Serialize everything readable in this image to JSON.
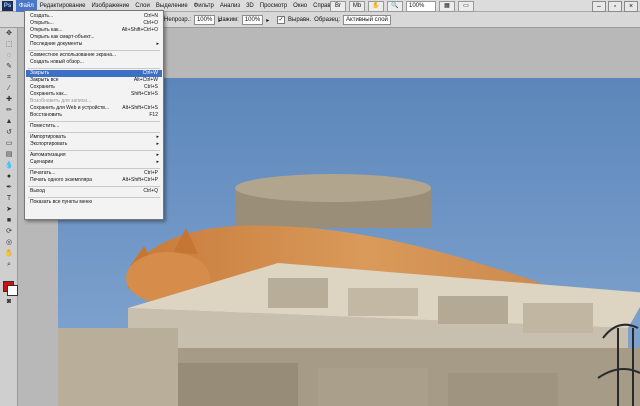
{
  "app": {
    "logo": "Ps"
  },
  "menubar": {
    "items": [
      "Файл",
      "Редактирование",
      "Изображение",
      "Слои",
      "Выделение",
      "Фильтр",
      "Анализ",
      "3D",
      "Просмотр",
      "Окно",
      "Справка"
    ],
    "active_index": 0,
    "zoom": "100%"
  },
  "options": {
    "opacity_label": "Непрозр.:",
    "opacity_value": "100%",
    "pressure_label": "Нажим:",
    "pressure_value": "100%",
    "align_label": "Выравн.",
    "sample_label": "Образец:",
    "sample_value": "Активный слой"
  },
  "file_menu": {
    "items": [
      {
        "label": "Создать...",
        "shortcut": "Ctrl+N"
      },
      {
        "label": "Открыть...",
        "shortcut": "Ctrl+O"
      },
      {
        "label": "Открыть как...",
        "shortcut": "Alt+Shift+Ctrl+O"
      },
      {
        "label": "Открыть как смарт-объект..."
      },
      {
        "label": "Последние документы",
        "submenu": true
      },
      {
        "label": "Совместное использование экрана..."
      },
      {
        "label": "Создать новый обзор..."
      },
      {
        "label": "Закрыть",
        "shortcut": "Ctrl+W",
        "highlighted": true
      },
      {
        "label": "Закрыть все",
        "shortcut": "Alt+Ctrl+W"
      },
      {
        "label": "Сохранить",
        "shortcut": "Ctrl+S"
      },
      {
        "label": "Сохранить как...",
        "shortcut": "Shift+Ctrl+S"
      },
      {
        "label": "Возобновить для записи...",
        "disabled": true
      },
      {
        "label": "Сохранить для Web и устройств...",
        "shortcut": "Alt+Shift+Ctrl+S"
      },
      {
        "label": "Восстановить",
        "shortcut": "F12"
      },
      {
        "label": "Поместить..."
      },
      {
        "label": "Импортировать",
        "submenu": true
      },
      {
        "label": "Экспортировать",
        "submenu": true
      },
      {
        "label": "Автоматизация",
        "submenu": true
      },
      {
        "label": "Сценарии",
        "submenu": true
      },
      {
        "label": "Печатать...",
        "shortcut": "Ctrl+P"
      },
      {
        "label": "Печать одного экземпляра",
        "shortcut": "Alt+Shift+Ctrl+P"
      },
      {
        "label": "Выход",
        "shortcut": "Ctrl+Q"
      },
      {
        "label": "Показать все пункты меню"
      }
    ]
  },
  "colors": {
    "accent": "#3d6fc4",
    "foreground": "#cc1111",
    "background": "#ffffff"
  }
}
